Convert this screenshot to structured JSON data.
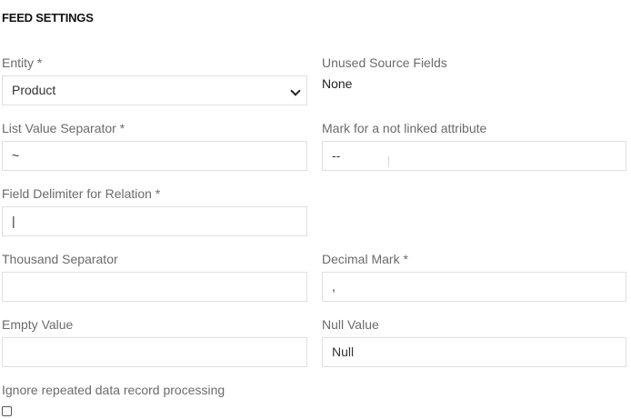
{
  "section": {
    "title": "FEED SETTINGS"
  },
  "fields": {
    "entity": {
      "label": "Entity *",
      "value": "Product"
    },
    "unused_source_fields": {
      "label": "Unused Source Fields",
      "value": "None"
    },
    "list_value_separator": {
      "label": "List Value Separator *",
      "value": "~"
    },
    "not_linked_mark": {
      "label": "Mark for a not linked attribute",
      "value": "--"
    },
    "field_delimiter_relation": {
      "label": "Field Delimiter for Relation *",
      "value": "|"
    },
    "thousand_separator": {
      "label": "Thousand Separator",
      "value": ""
    },
    "decimal_mark": {
      "label": "Decimal Mark *",
      "value": ","
    },
    "empty_value": {
      "label": "Empty Value",
      "value": ""
    },
    "null_value": {
      "label": "Null Value",
      "value": "Null"
    },
    "ignore_repeated": {
      "label": "Ignore repeated data record processing",
      "checked": false
    }
  },
  "icons": {
    "select_chevron": "chevron-down-icon"
  }
}
